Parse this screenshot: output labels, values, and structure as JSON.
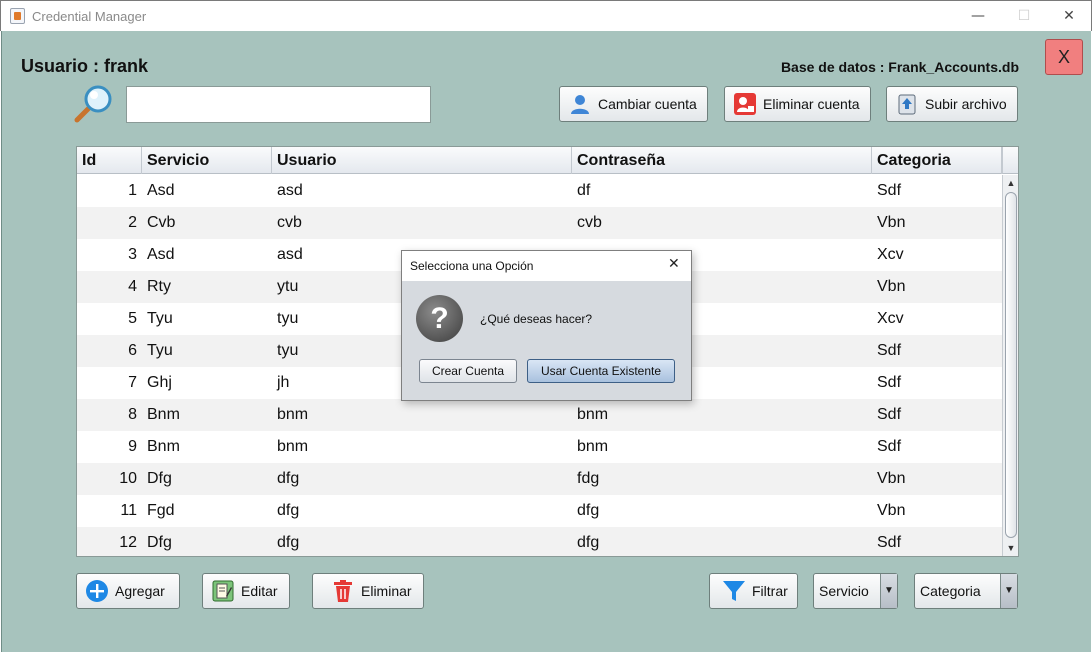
{
  "window": {
    "title": "Credential Manager"
  },
  "header": {
    "user_label": "Usuario : frank",
    "db_label": "Base de datos : Frank_Accounts.db",
    "exit_label": "X"
  },
  "search": {
    "value": "",
    "placeholder": ""
  },
  "toolbar": {
    "change_account": "Cambiar cuenta",
    "delete_account": "Eliminar cuenta",
    "upload_file": "Subir archivo"
  },
  "table": {
    "columns": [
      "Id",
      "Servicio",
      "Usuario",
      "Contraseña",
      "Categoria"
    ],
    "rows": [
      [
        "1",
        "Asd",
        "asd",
        "df",
        "Sdf"
      ],
      [
        "2",
        "Cvb",
        "cvb",
        "cvb",
        "Vbn"
      ],
      [
        "3",
        "Asd",
        "asd",
        "",
        "Xcv"
      ],
      [
        "4",
        "Rty",
        "ytu",
        "",
        "Vbn"
      ],
      [
        "5",
        "Tyu",
        "tyu",
        "",
        "Xcv"
      ],
      [
        "6",
        "Tyu",
        "tyu",
        "",
        "Sdf"
      ],
      [
        "7",
        "Ghj",
        "jh",
        "",
        "Sdf"
      ],
      [
        "8",
        "Bnm",
        "bnm",
        "bnm",
        "Sdf"
      ],
      [
        "9",
        "Bnm",
        "bnm",
        "bnm",
        "Sdf"
      ],
      [
        "10",
        "Dfg",
        "dfg",
        "fdg",
        "Vbn"
      ],
      [
        "11",
        "Fgd",
        "dfg",
        "dfg",
        "Vbn"
      ],
      [
        "12",
        "Dfg",
        "dfg",
        "dfg",
        "Sdf"
      ]
    ]
  },
  "footer": {
    "add": "Agregar",
    "edit": "Editar",
    "delete": "Eliminar",
    "filter": "Filtrar",
    "service_combo": "Servicio",
    "category_combo": "Categoria"
  },
  "dialog": {
    "title": "Selecciona una Opción",
    "message": "¿Qué deseas hacer?",
    "create_button": "Crear Cuenta",
    "use_button": "Usar Cuenta Existente",
    "icon": "question-icon"
  },
  "colors": {
    "background": "#a7c3bd",
    "exit_button": "#f17f7f",
    "add_icon": "#1e88e5",
    "delete_icon": "#e53935",
    "filter_icon": "#1e88e5"
  }
}
